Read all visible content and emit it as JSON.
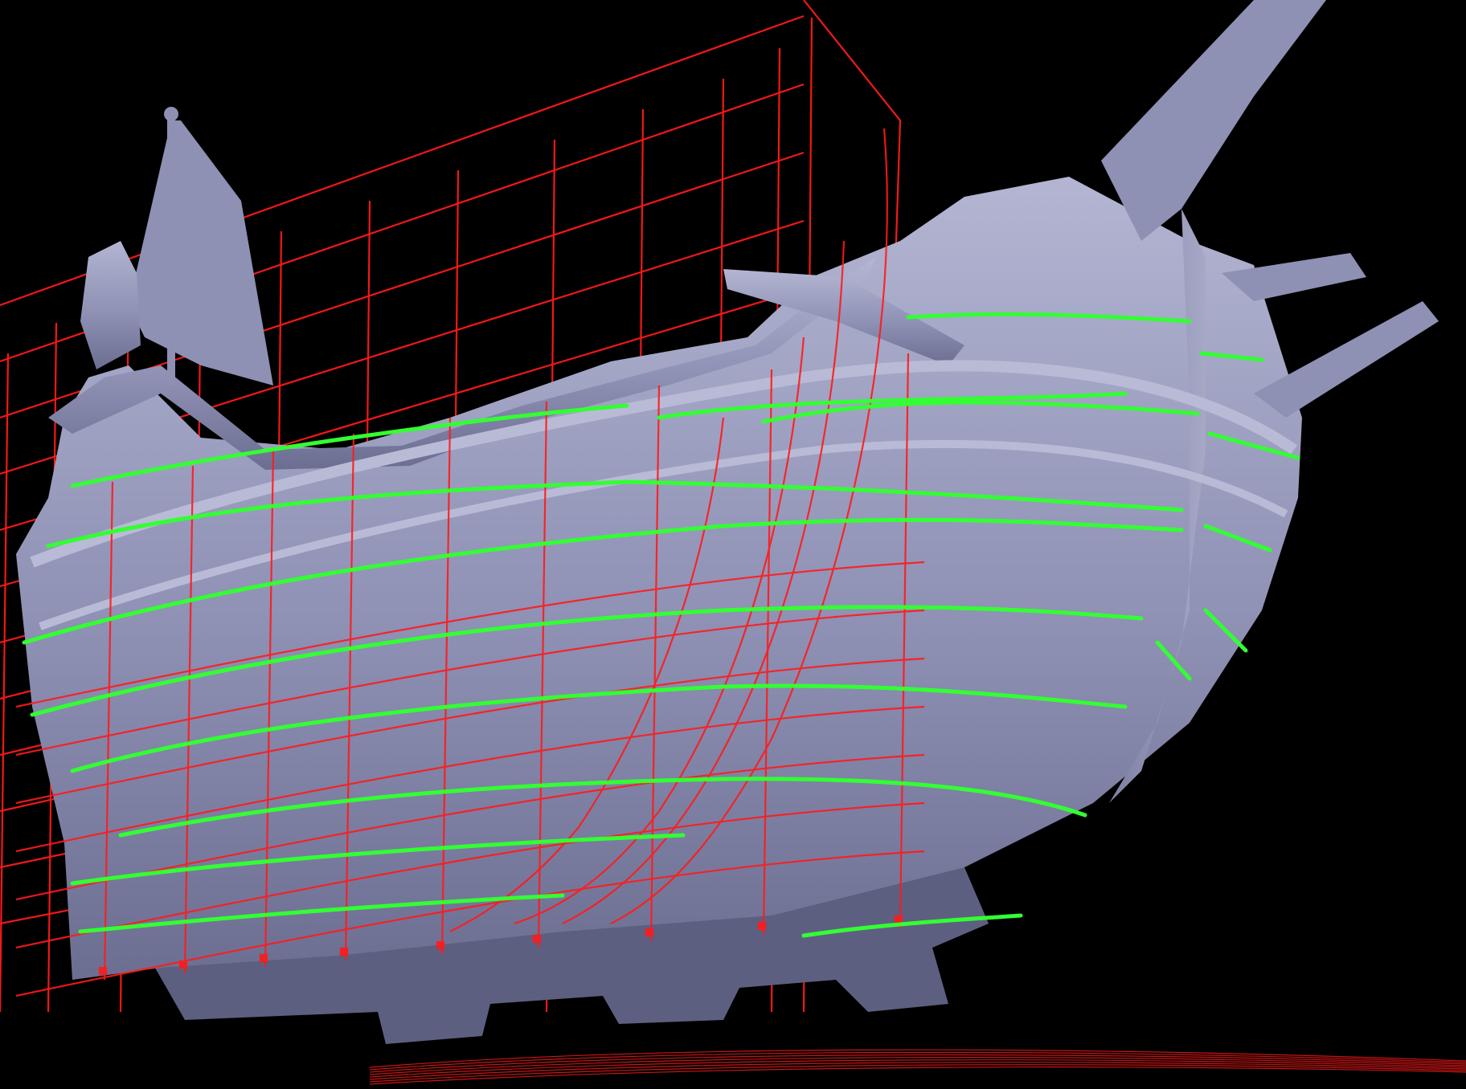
{
  "scene": {
    "subject": "ship-hull-3d-scan",
    "colors": {
      "background": "#000000",
      "hull": "#8e90b4",
      "hull_shadow": "#5d5f80",
      "hull_highlight": "#b9bbd6",
      "grid_lines": "#ff1a1a",
      "waterlines": "#33ff33"
    },
    "layers": [
      "background",
      "red-construction-grid",
      "hull-scan",
      "red-frame-curves",
      "green-waterlines",
      "floor-reflection"
    ]
  }
}
